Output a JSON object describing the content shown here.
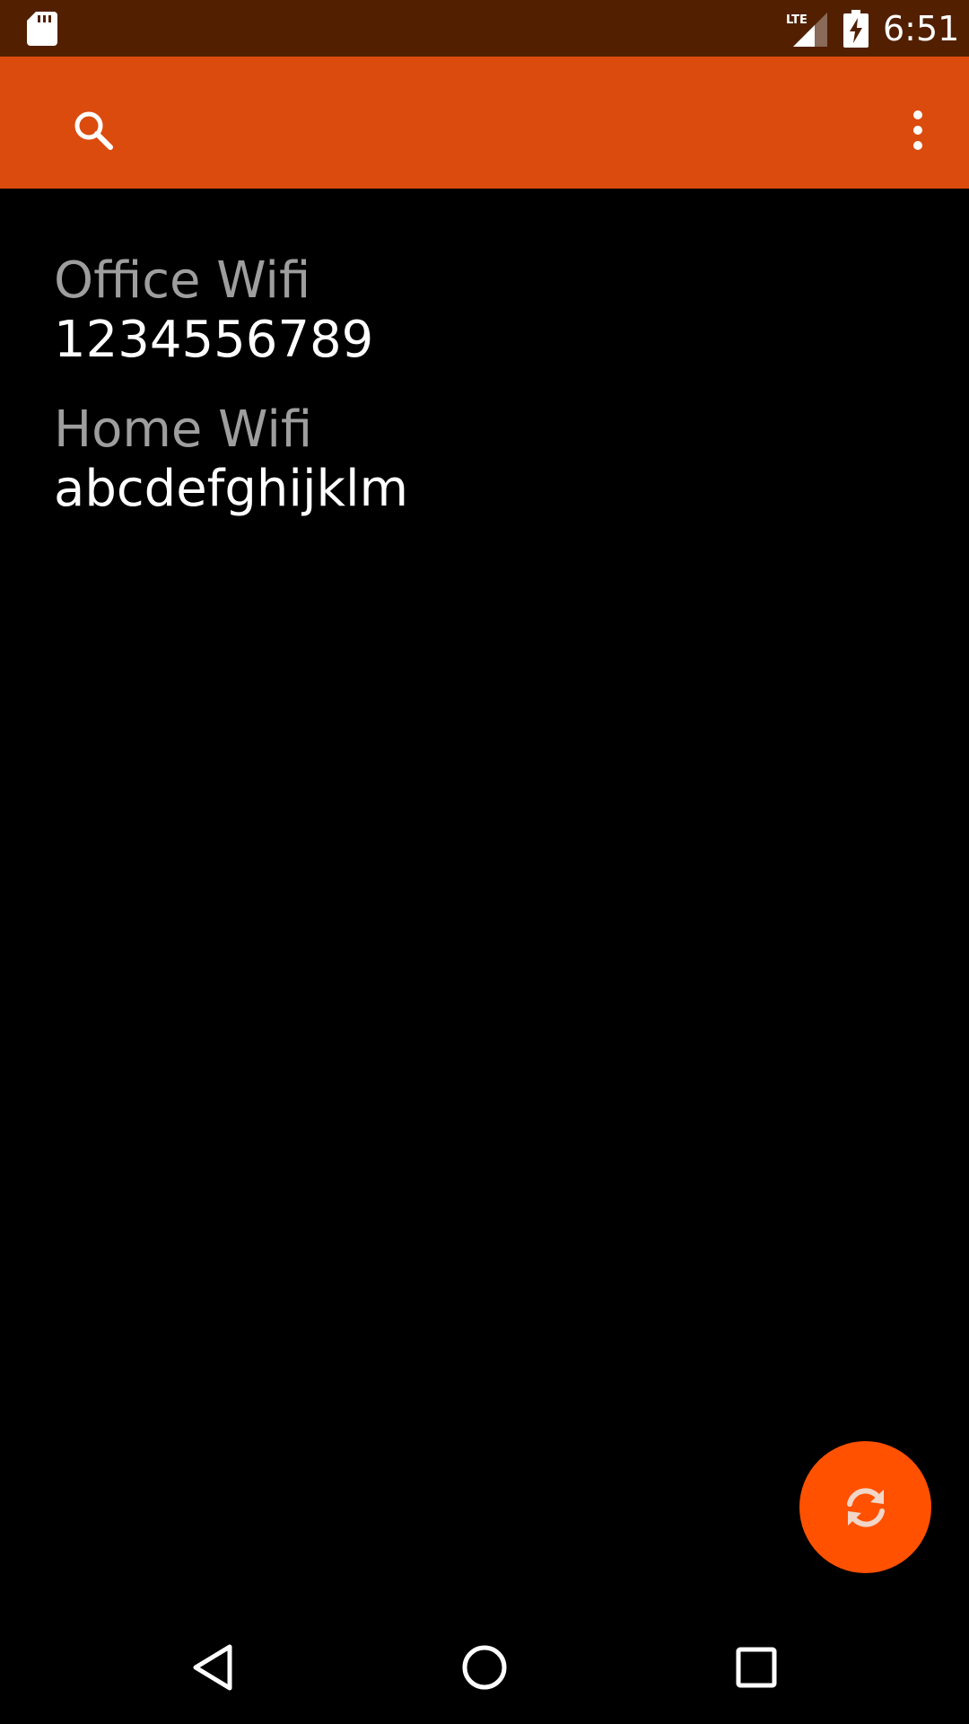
{
  "status_bar": {
    "time": "6:51",
    "network_label": "LTE",
    "icons": [
      "sd-card-icon",
      "lte-signal-icon",
      "battery-charging-icon"
    ]
  },
  "app_bar": {
    "color": "#db4b0e",
    "icons": [
      "search-icon",
      "more-vert-icon"
    ]
  },
  "wifi_list": [
    {
      "name": "Office Wifi",
      "password": "1234556789"
    },
    {
      "name": "Home Wifi",
      "password": "abcdefghijklm"
    }
  ],
  "fab": {
    "icon": "refresh-icon",
    "color": "#ff5100"
  },
  "nav_bar": {
    "icons": [
      "back-icon",
      "home-icon",
      "recents-icon"
    ]
  }
}
